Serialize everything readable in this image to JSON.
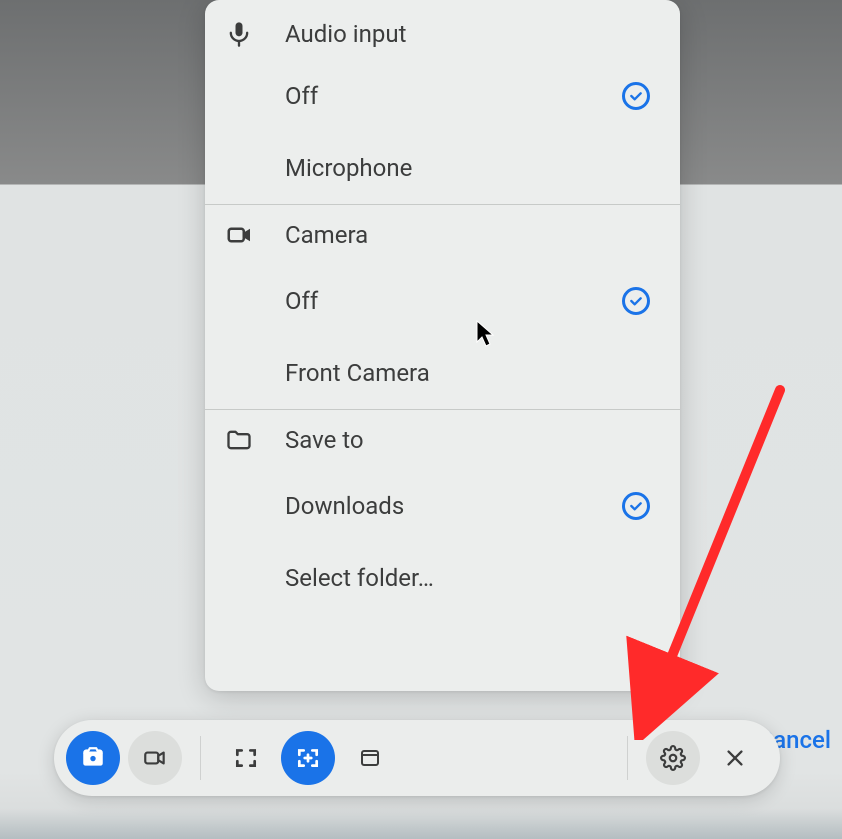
{
  "settings": {
    "sections": {
      "audio": {
        "title": "Audio input",
        "options": {
          "off": {
            "label": "Off",
            "selected": true
          },
          "mic": {
            "label": "Microphone",
            "selected": false
          }
        }
      },
      "camera": {
        "title": "Camera",
        "options": {
          "off": {
            "label": "Off",
            "selected": true
          },
          "front": {
            "label": "Front Camera",
            "selected": false
          }
        }
      },
      "saveto": {
        "title": "Save to",
        "options": {
          "downloads": {
            "label": "Downloads",
            "selected": true
          },
          "select": {
            "label": "Select folder…",
            "selected": false
          }
        }
      }
    }
  },
  "toolbar": {
    "buttons": {
      "screenshot": "Screenshot",
      "record": "Screen record",
      "fullscreen": "Full screen",
      "partial": "Partial screen",
      "window": "Window",
      "settings": "Settings",
      "close": "Close"
    }
  },
  "actions": {
    "cancel": "Cancel"
  },
  "colors": {
    "accent": "#1a73e8",
    "panel": "#eceeed",
    "text": "#3c3d3d"
  }
}
